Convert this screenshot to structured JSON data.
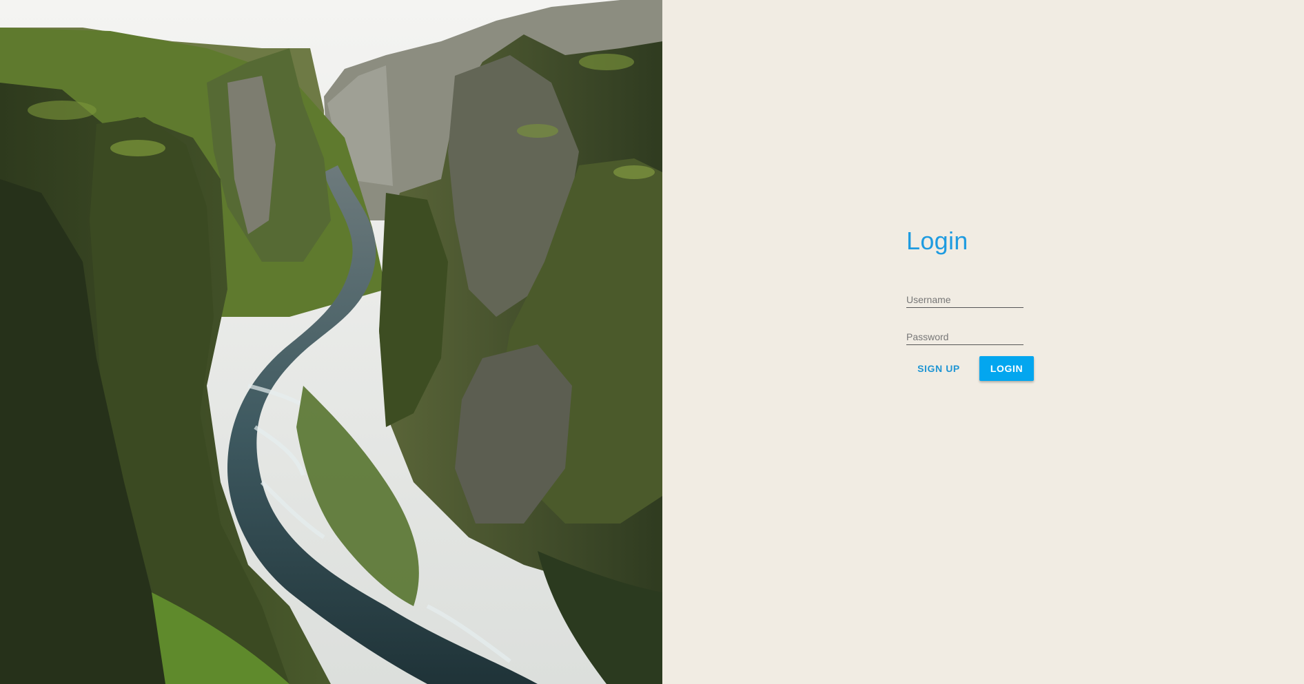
{
  "hero": {
    "image": "canyon-river-photo"
  },
  "login": {
    "title": "Login",
    "username": {
      "placeholder": "Username",
      "value": ""
    },
    "password": {
      "placeholder": "Password",
      "value": ""
    },
    "signup_label": "SIGN UP",
    "login_label": "LOGIN"
  },
  "colors": {
    "accent": "#1e9be0",
    "login_button": "#03a6ef",
    "panel_background": "#f1ece3"
  }
}
